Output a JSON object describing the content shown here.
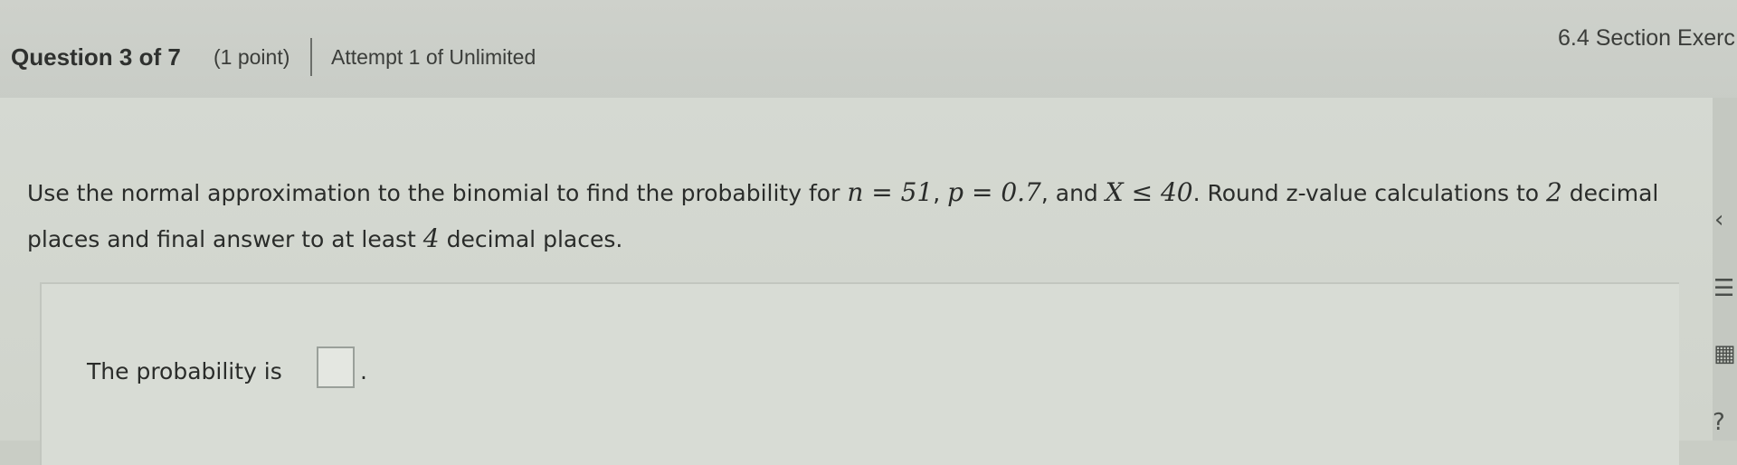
{
  "header": {
    "question_title": "Question 3 of 7",
    "points": "(1 point)",
    "attempt": "Attempt 1 of Unlimited",
    "section": "6.4 Section Exerc"
  },
  "question": {
    "text_part1": "Use the normal approximation to the binomial to find the probability for ",
    "math_n": "n = 51",
    "sep1": ", ",
    "math_p": "p = 0.7",
    "sep2": ", and ",
    "math_x": "X ≤ 40",
    "text_part2": ". Round z-value calculations to ",
    "round_places": "2",
    "text_part3": " decimal places and final answer to at least ",
    "final_places": "4",
    "text_part4": " decimal places."
  },
  "answer": {
    "label": "The probability is",
    "value": "",
    "period": "."
  },
  "rail": {
    "icons": [
      "chevron-left-icon",
      "list-icon",
      "calculator-icon",
      "help-icon"
    ]
  }
}
